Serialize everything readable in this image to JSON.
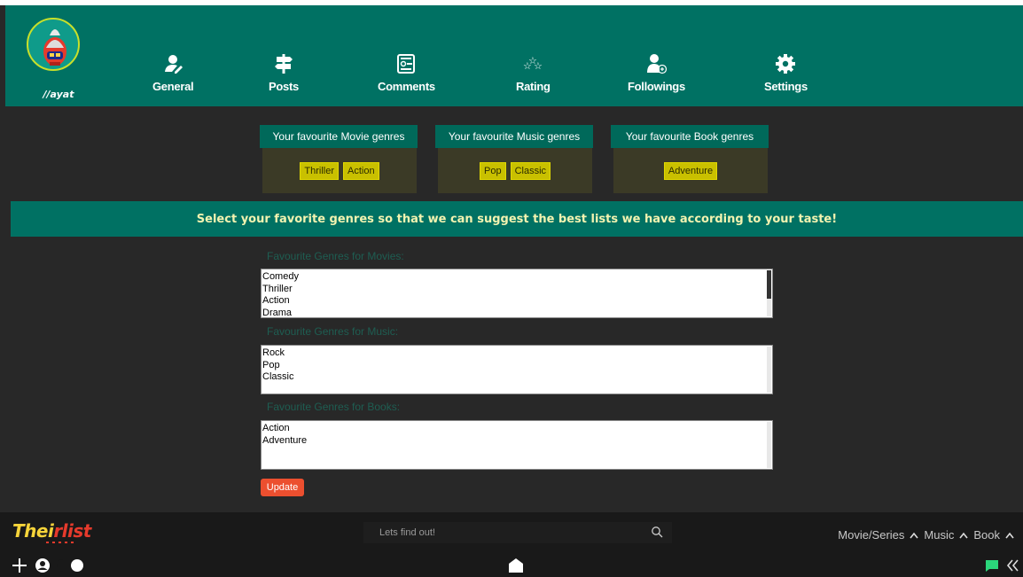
{
  "user": {
    "handle": "//ayat"
  },
  "nav": [
    {
      "label": "General",
      "icon": "user-edit-icon"
    },
    {
      "label": "Posts",
      "icon": "signpost-icon"
    },
    {
      "label": "Comments",
      "icon": "comments-icon"
    },
    {
      "label": "Rating",
      "icon": "stars-icon"
    },
    {
      "label": "Followings",
      "icon": "user-plus-icon"
    },
    {
      "label": "Settings",
      "icon": "gear-icon"
    }
  ],
  "favorites": [
    {
      "title": "Your favourite Movie genres",
      "tags": [
        "Thriller",
        "Action"
      ]
    },
    {
      "title": "Your favourite Music genres",
      "tags": [
        "Pop",
        "Classic"
      ]
    },
    {
      "title": "Your favourite Book genres",
      "tags": [
        "Adventure"
      ]
    }
  ],
  "banner": "Select your favorite genres so that we can suggest the best lists we have according to your taste!",
  "forms": [
    {
      "label": "Favourite Genres for Movies:",
      "options": [
        "Comedy",
        "Thriller",
        "Action",
        "Drama"
      ]
    },
    {
      "label": "Favourite Genres for Music:",
      "options": [
        "Rock",
        "Pop",
        "Classic"
      ]
    },
    {
      "label": "Favourite Genres for Books:",
      "options": [
        "Action",
        "Adventure"
      ]
    }
  ],
  "update_label": "Update",
  "footer": {
    "logo": "Theirlist",
    "search_placeholder": "Lets find out!",
    "categories": [
      "Movie/Series",
      "Music",
      "Book"
    ]
  },
  "colors": {
    "header": "#007163",
    "tag": "#c9c000",
    "update": "#ec4f2f",
    "accent_green": "#2bd67b"
  }
}
